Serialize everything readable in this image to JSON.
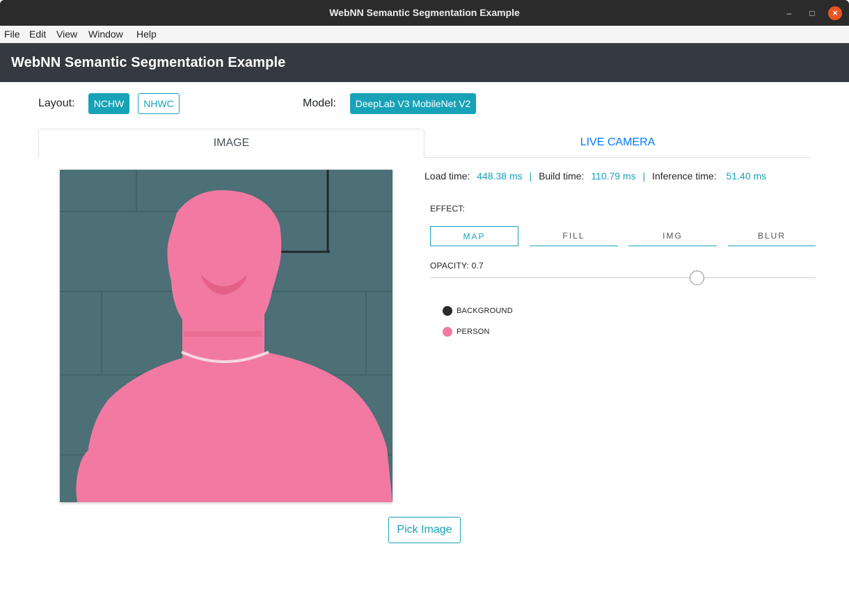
{
  "window": {
    "title": "WebNN Semantic Segmentation Example",
    "minimize_icon": "minimize-icon",
    "maximize_icon": "maximize-icon",
    "close_icon": "close-icon"
  },
  "menu": [
    "File",
    "Edit",
    "View",
    "Window",
    "Help"
  ],
  "header": {
    "title": "WebNN Semantic Segmentation Example"
  },
  "controls": {
    "layout_label": "Layout:",
    "layout_options": [
      "NCHW",
      "NHWC"
    ],
    "layout_selected": "NCHW",
    "model_label": "Model:",
    "model_selected": "DeepLab V3 MobileNet V2"
  },
  "tabs": [
    {
      "label": "IMAGE",
      "active": true
    },
    {
      "label": "LIVE CAMERA",
      "active": false
    }
  ],
  "timings": {
    "load_label": "Load time:",
    "load_value": "448.38 ms",
    "build_label": "Build time:",
    "build_value": "110.79 ms",
    "inference_label": "Inference time:",
    "inference_value": "51.40 ms",
    "separator": "|"
  },
  "effect": {
    "label": "EFFECT:",
    "options": [
      "MAP",
      "FILL",
      "IMG",
      "BLUR"
    ],
    "selected": "MAP"
  },
  "opacity": {
    "label": "OPACITY: 0.7",
    "value": 0.7
  },
  "legend": [
    {
      "label": "BACKGROUND",
      "color": "#2b2b2b"
    },
    {
      "label": "PERSON",
      "color": "#f27aa2"
    }
  ],
  "colors": {
    "accent": "#17a2b8",
    "header_bg": "#343a40",
    "person_overlay": "#f0628c",
    "background_overlay": "#4b6e75"
  },
  "pick_image_label": "Pick Image"
}
